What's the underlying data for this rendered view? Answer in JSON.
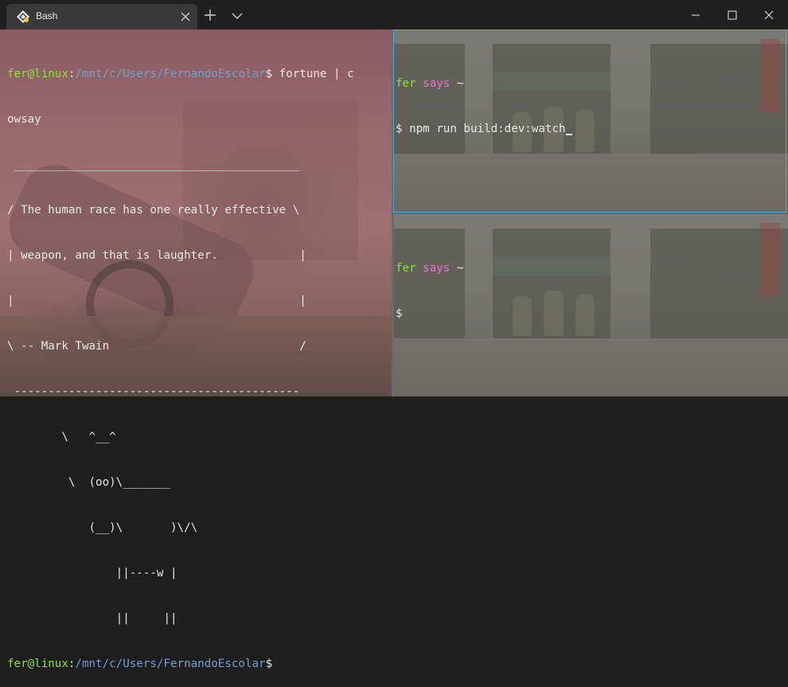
{
  "tab": {
    "title": "Bash"
  },
  "colors": {
    "accent_border": "#46a8d8",
    "prompt_user": "#8ae234",
    "prompt_path": "#729fcf",
    "says": "#f070c8"
  },
  "icons": {
    "app": "linux-penguin-icon",
    "close_tab": "close-icon",
    "new_tab": "plus-icon",
    "dropdown": "chevron-down-icon",
    "minimize": "minimize-icon",
    "maximize": "maximize-icon",
    "close_window": "close-icon"
  },
  "left_pane": {
    "prompt1_user": "fer@linux",
    "prompt1_sep": ":",
    "prompt1_path": "/mnt/c/Users/FernandoEscolar",
    "prompt1_dollar": "$",
    "command1_a": " fortune | c",
    "command1_b": "owsay",
    "cowsay": [
      " __________________________________________",
      "/ The human race has one really effective \\",
      "| weapon, and that is laughter.            |",
      "|                                          |",
      "\\ -- Mark Twain                            /",
      " ------------------------------------------",
      "        \\   ^__^",
      "         \\  (oo)\\_______",
      "            (__)\\       )\\/\\",
      "                ||----w |",
      "                ||     ||"
    ],
    "prompt2_user": "fer@linux",
    "prompt2_sep": ":",
    "prompt2_path": "/mnt/c/Users/FernandoEscolar",
    "prompt2_dollar": "$"
  },
  "right_top_pane": {
    "prompt_name": "fer",
    "prompt_says": "says",
    "prompt_tilde": "~",
    "dollar": "$",
    "command": " npm run build:dev:watch"
  },
  "right_bottom_pane": {
    "prompt_name": "fer",
    "prompt_says": "says",
    "prompt_tilde": "~",
    "dollar": "$"
  }
}
